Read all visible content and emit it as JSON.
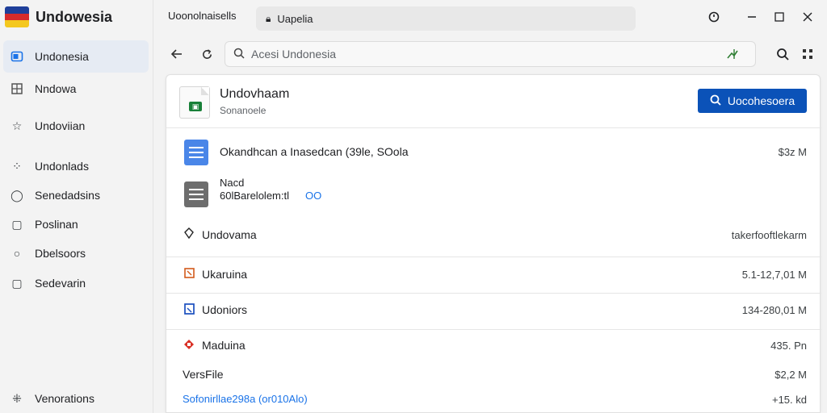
{
  "app": {
    "title": "Undowesia",
    "flag_colors": [
      "#1e3f9a",
      "#d62b2b",
      "#f4c81f"
    ]
  },
  "sidebar": {
    "items": [
      {
        "label": "Undonesia",
        "icon": "window-icon",
        "active": true
      },
      {
        "label": "Nndowa",
        "icon": "grid-icon"
      },
      {
        "label": "Undoviian",
        "icon": "star-icon"
      },
      {
        "label": "Undonlads",
        "icon": "apps-icon"
      },
      {
        "label": "Senedadsins",
        "icon": "circle-icon"
      },
      {
        "label": "Poslinan",
        "icon": "square-icon"
      },
      {
        "label": "Dbelsoors",
        "icon": "radio-icon"
      },
      {
        "label": "Sedevarin",
        "icon": "tag-icon"
      }
    ],
    "bottom": {
      "label": "Venorations",
      "icon": "settings-icon"
    }
  },
  "titlebar": {
    "title": "Uoonolnaisells",
    "tab_label": "Uapelia"
  },
  "toolbar": {
    "search_value": "Acesi Undonesia"
  },
  "panel": {
    "title": "Undovhaam",
    "subtitle": "Sonanoele",
    "button_label": "Uocohesoera"
  },
  "rows": [
    {
      "label": "Okandhcan a Inasedcan (39le, SOola",
      "value": "$3z M",
      "icon": "doc-blue"
    },
    {
      "label_top": "Nacd",
      "label": "60lBarelolem:tl",
      "link": "OO",
      "icon": "doc-gray"
    },
    {
      "label": "Undovama",
      "value": "takerfooftlekarm",
      "icon": "shield-icon"
    },
    {
      "label": "Ukaruina",
      "value": "5.1-12,7,01 M",
      "icon": "orange-square-icon"
    },
    {
      "label": "Udoniors",
      "value": "134-280,01 M",
      "icon": "blue-file-icon"
    },
    {
      "label": "Maduina",
      "value": "435. Pn",
      "icon": "red-diamond-icon"
    },
    {
      "label": "VersFile",
      "value": "$2,2 M"
    },
    {
      "label": "Sofonirllae298a (or010Alo)",
      "value": "+15. kd"
    }
  ]
}
